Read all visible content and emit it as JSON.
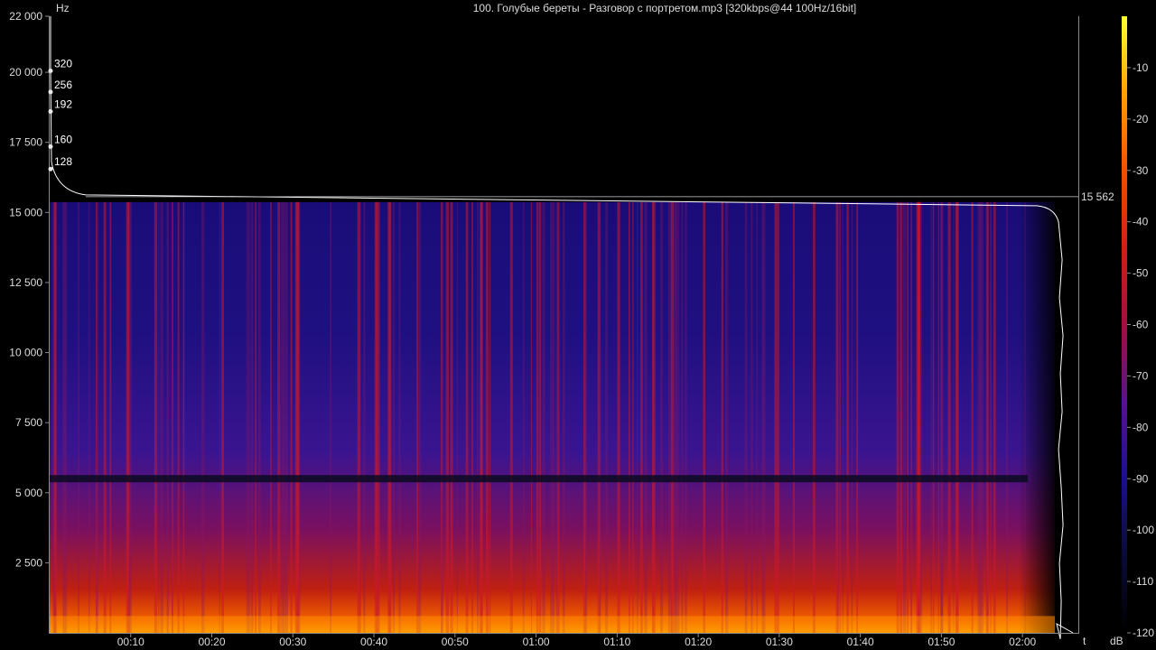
{
  "title": "100. Голубые береты - Разговор с портретом.mp3 [320kbps@44 100Hz/16bit]",
  "chart_data": {
    "type": "heatmap",
    "title": "100. Голубые береты - Разговор с портретом.mp3 [320kbps@44 100Hz/16bit]",
    "x_unit": "t",
    "y_unit": "Hz",
    "colorbar_unit": "dB",
    "y_range": [
      0,
      22000
    ],
    "x_range_seconds": [
      0,
      127
    ],
    "audio_end_seconds": 124,
    "y_ticks": [
      {
        "value": 22000,
        "label": "22 000"
      },
      {
        "value": 20000,
        "label": "20 000"
      },
      {
        "value": 17500,
        "label": "17 500"
      },
      {
        "value": 15000,
        "label": "15 000"
      },
      {
        "value": 12500,
        "label": "12 500"
      },
      {
        "value": 10000,
        "label": "10 000"
      },
      {
        "value": 7500,
        "label": "7 500"
      },
      {
        "value": 5000,
        "label": "5 000"
      },
      {
        "value": 2500,
        "label": "2 500"
      }
    ],
    "x_ticks": [
      {
        "value": 10,
        "label": "00:10"
      },
      {
        "value": 20,
        "label": "00:20"
      },
      {
        "value": 30,
        "label": "00:30"
      },
      {
        "value": 40,
        "label": "00:40"
      },
      {
        "value": 50,
        "label": "00:50"
      },
      {
        "value": 60,
        "label": "01:00"
      },
      {
        "value": 70,
        "label": "01:10"
      },
      {
        "value": 80,
        "label": "01:20"
      },
      {
        "value": 90,
        "label": "01:30"
      },
      {
        "value": 100,
        "label": "01:40"
      },
      {
        "value": 110,
        "label": "01:50"
      },
      {
        "value": 120,
        "label": "02:00"
      }
    ],
    "colorbar_range": [
      -120,
      0
    ],
    "colorbar_ticks": [
      {
        "value": -10,
        "label": "-10"
      },
      {
        "value": -20,
        "label": "-20"
      },
      {
        "value": -30,
        "label": "-30"
      },
      {
        "value": -40,
        "label": "-40"
      },
      {
        "value": -50,
        "label": "-50"
      },
      {
        "value": -60,
        "label": "-60"
      },
      {
        "value": -70,
        "label": "-70"
      },
      {
        "value": -80,
        "label": "-80"
      },
      {
        "value": -90,
        "label": "-90"
      },
      {
        "value": -100,
        "label": "-100"
      },
      {
        "value": -110,
        "label": "-110"
      },
      {
        "value": -120,
        "label": "-120"
      }
    ],
    "cutoff_frequency": 15562,
    "cutoff_label": "15 562",
    "bitrate_markers": [
      {
        "label": "320",
        "frequency": 20050
      },
      {
        "label": "256",
        "frequency": 19300
      },
      {
        "label": "192",
        "frequency": 18600
      },
      {
        "label": "160",
        "frequency": 17350
      },
      {
        "label": "128",
        "frequency": 16550
      }
    ],
    "dark_band_frequency": 5500,
    "colorscale": [
      "#000000",
      "#0a0a3a",
      "#1a108a",
      "#5a1090",
      "#a01040",
      "#d02010",
      "#f05000",
      "#ffa000",
      "#ffff30"
    ]
  }
}
